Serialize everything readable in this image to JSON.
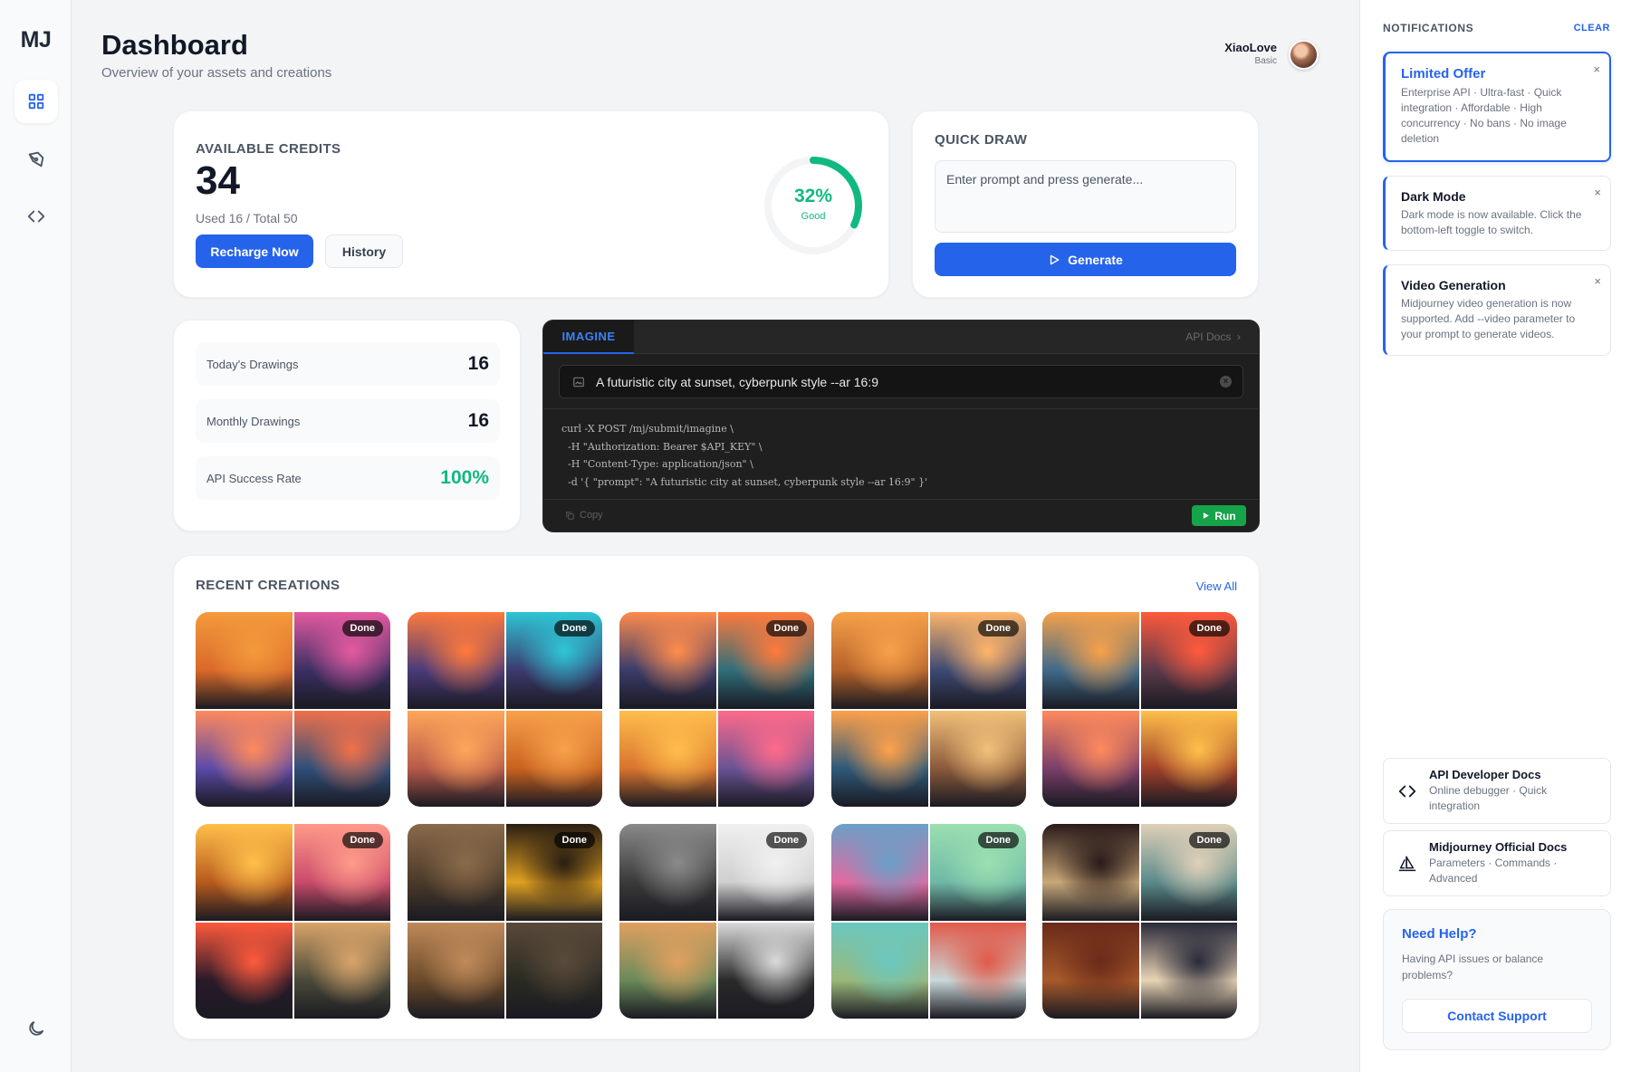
{
  "app": {
    "logo": "MJ"
  },
  "nav": {
    "items": [
      {
        "name": "dashboard",
        "icon": "grid-icon",
        "active": true
      },
      {
        "name": "draw",
        "icon": "pen-tool-icon",
        "active": false
      },
      {
        "name": "api",
        "icon": "code-icon",
        "active": false
      }
    ],
    "bottom_icon": "moon-icon"
  },
  "header": {
    "title": "Dashboard",
    "subtitle": "Overview of your assets and creations"
  },
  "user": {
    "name": "XiaoLove",
    "plan": "Basic"
  },
  "credits": {
    "label": "AVAILABLE CREDITS",
    "value": "34",
    "used_text": "Used 16 / Total 50",
    "recharge_label": "Recharge Now",
    "history_label": "History",
    "gauge_percent_text": "32%",
    "gauge_percent": 32,
    "gauge_status": "Good",
    "gauge_color": "#10b981"
  },
  "quick_draw": {
    "label": "QUICK DRAW",
    "placeholder": "Enter prompt and press generate...",
    "generate_label": "Generate"
  },
  "stats": [
    {
      "label": "Today's Drawings",
      "value": "16"
    },
    {
      "label": "Monthly Drawings",
      "value": "16"
    },
    {
      "label": "API Success Rate",
      "value": "100%"
    }
  ],
  "imagine": {
    "tab": "IMAGINE",
    "docs_link": "API Docs",
    "prompt": "A futuristic city at sunset, cyberpunk style --ar 16:9",
    "code": "curl -X POST /mj/submit/imagine \\\n  -H \"Authorization: Bearer $API_KEY\" \\\n  -H \"Content-Type: application/json\" \\\n  -d '{ \"prompt\": \"A futuristic city at sunset, cyberpunk style --ar 16:9\" }'",
    "copy_label": "Copy",
    "run_label": "Run"
  },
  "recent": {
    "label": "RECENT CREATIONS",
    "view_all": "View All",
    "status_label": "Done",
    "tiles": [
      {
        "colors": [
          "#d9692a",
          "#3b2f63",
          "#5b4aa8",
          "#2f4f7a"
        ],
        "accents": [
          "#f49a3c",
          "#e45aa0",
          "#ff8a5c",
          "#f0704a"
        ]
      },
      {
        "colors": [
          "#4a3b7a",
          "#3c3a6e",
          "#b75a4a",
          "#c9621f"
        ],
        "accents": [
          "#ff7a3c",
          "#2ec6d6",
          "#ffa65a",
          "#f7a14a"
        ]
      },
      {
        "colors": [
          "#3a3c6a",
          "#2f6e7a",
          "#d9742e",
          "#6a5394"
        ],
        "accents": [
          "#ff8c4c",
          "#ff7a3c",
          "#ffbe4c",
          "#ff6a8a"
        ]
      },
      {
        "colors": [
          "#b4622a",
          "#3d4a74",
          "#2f5a7a",
          "#8a5a3a"
        ],
        "accents": [
          "#f7a14a",
          "#ffb56a",
          "#ffa14a",
          "#f2c07a"
        ]
      },
      {
        "colors": [
          "#3f6a8a",
          "#5a3a4a",
          "#7a3f6a",
          "#a0402a"
        ],
        "accents": [
          "#f7a14a",
          "#ff5a3c",
          "#ff8a5c",
          "#ffc04a"
        ]
      },
      {
        "colors": [
          "#b85a1e",
          "#c94a6a",
          "#2a1a2a",
          "#4a4a3a"
        ],
        "accents": [
          "#ffc04a",
          "#ff9a8a",
          "#ff5a3c",
          "#d9a46a"
        ]
      },
      {
        "colors": [
          "#4a3a2a",
          "#e0a020",
          "#6a4a2a",
          "#2a2a22"
        ],
        "accents": [
          "#8a6a4a",
          "#2a1e12",
          "#c08a5a",
          "#5a4a3a"
        ]
      },
      {
        "colors": [
          "#3a3a3a",
          "#cfcfcf",
          "#6a8a5a",
          "#2a2a2a"
        ],
        "accents": [
          "#8a8a8a",
          "#f0f0f0",
          "#e0a060",
          "#dadada"
        ]
      },
      {
        "colors": [
          "#e06aa0",
          "#6fb8a8",
          "#9ab87a",
          "#c8d8d8"
        ],
        "accents": [
          "#6aa0c8",
          "#9ae0b0",
          "#6ac8c0",
          "#e05a4a"
        ]
      },
      {
        "colors": [
          "#c8a878",
          "#5a8a8a",
          "#a85a2a",
          "#e8d4b4"
        ],
        "accents": [
          "#2a1a1a",
          "#e0d0b8",
          "#6a2a1a",
          "#2a2a3a"
        ]
      }
    ]
  },
  "notifications": {
    "title": "NOTIFICATIONS",
    "clear_label": "CLEAR",
    "items": [
      {
        "title": "Limited Offer",
        "body": "Enterprise API · Ultra-fast · Quick integration · Affordable · High concurrency · No bans · No image deletion",
        "highlight": true
      },
      {
        "title": "Dark Mode",
        "body": "Dark mode is now available. Click the bottom-left toggle to switch.",
        "highlight": false
      },
      {
        "title": "Video Generation",
        "body": "Midjourney video generation is now supported. Add --video parameter to your prompt to generate videos.",
        "highlight": false
      }
    ]
  },
  "docs": [
    {
      "title": "API Developer Docs",
      "subtitle": "Online debugger · Quick integration",
      "icon": "code-icon"
    },
    {
      "title": "Midjourney Official Docs",
      "subtitle": "Parameters · Commands · Advanced",
      "icon": "sailboat-icon"
    }
  ],
  "help": {
    "title": "Need Help?",
    "body": "Having API issues or balance problems?",
    "button_label": "Contact Support"
  }
}
